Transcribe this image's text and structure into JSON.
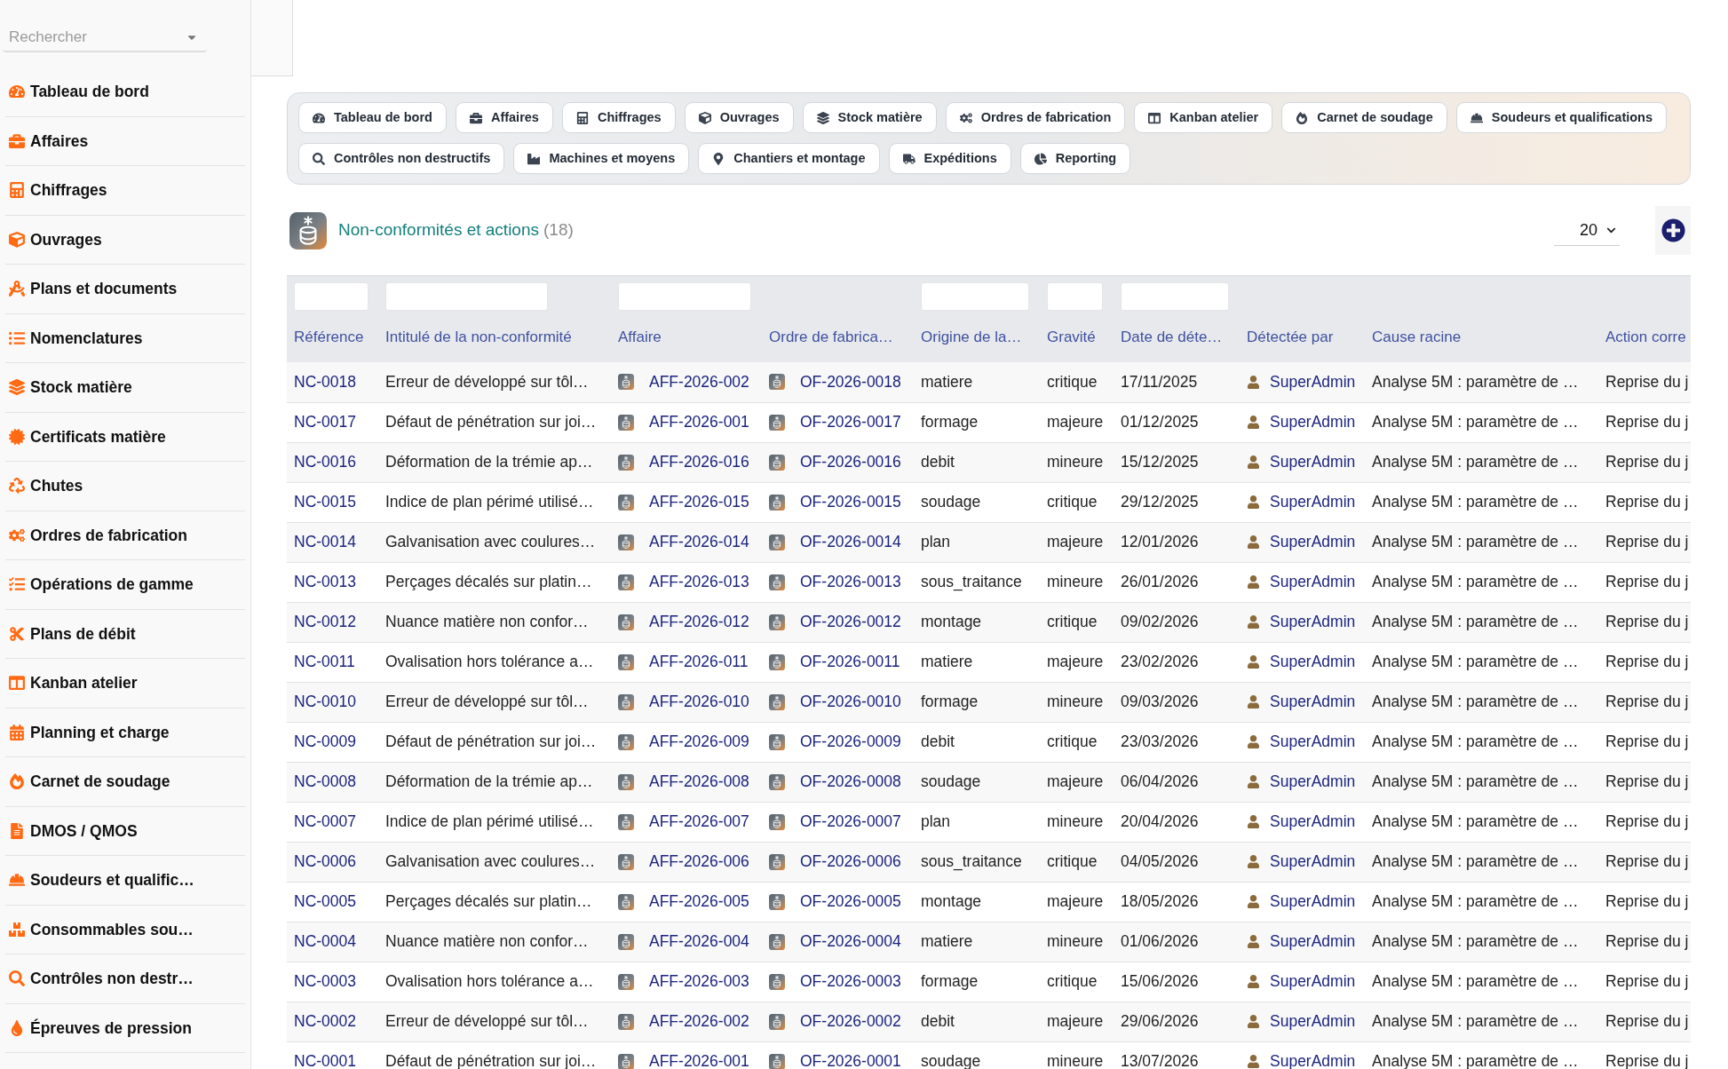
{
  "sidebar": {
    "search": {
      "placeholder": "Rechercher"
    },
    "items": [
      {
        "label": "Tableau de bord"
      },
      {
        "label": "Affaires"
      },
      {
        "label": "Chiffrages"
      },
      {
        "label": "Ouvrages"
      },
      {
        "label": "Plans et documents"
      },
      {
        "label": "Nomenclatures"
      },
      {
        "label": "Stock matière"
      },
      {
        "label": "Certificats matière"
      },
      {
        "label": "Chutes"
      },
      {
        "label": "Ordres de fabrication"
      },
      {
        "label": "Opérations de gamme"
      },
      {
        "label": "Plans de débit"
      },
      {
        "label": "Kanban atelier"
      },
      {
        "label": "Planning et charge"
      },
      {
        "label": "Carnet de soudage"
      },
      {
        "label": "DMOS / QMOS"
      },
      {
        "label": "Soudeurs et qualific…"
      },
      {
        "label": "Consommables sou…"
      },
      {
        "label": "Contrôles non destr…"
      },
      {
        "label": "Épreuves de pression"
      }
    ]
  },
  "shortcut_rows": [
    [
      {
        "label": "Tableau de bord"
      },
      {
        "label": "Affaires"
      },
      {
        "label": "Chiffrages"
      },
      {
        "label": "Ouvrages"
      },
      {
        "label": "Stock matière"
      },
      {
        "label": "Ordres de fabrication"
      },
      {
        "label": "Kanban atelier"
      },
      {
        "label": "Carnet de soudage"
      },
      {
        "label": "Soudeurs et qualifications"
      }
    ],
    [
      {
        "label": "Contrôles non destructifs"
      },
      {
        "label": "Machines et moyens"
      },
      {
        "label": "Chantiers et montage"
      },
      {
        "label": "Expéditions"
      },
      {
        "label": "Reporting"
      }
    ]
  ],
  "page_header": {
    "title": "Non-conformités et actions",
    "count": "(18)",
    "page_size": "20"
  },
  "table": {
    "columns": [
      {
        "label": "Référence",
        "filter": true
      },
      {
        "label": "Intitulé de la non-conformité",
        "filter": true
      },
      {
        "label": "Affaire",
        "filter": true
      },
      {
        "label": "Ordre de fabrica…",
        "filter": false
      },
      {
        "label": "Origine de la…",
        "filter": true
      },
      {
        "label": "Gravité",
        "filter": true
      },
      {
        "label": "Date de déte…",
        "filter": true
      },
      {
        "label": "Détectée par",
        "filter": false
      },
      {
        "label": "Cause racine",
        "filter": false
      },
      {
        "label": "Action corre",
        "filter": false
      }
    ],
    "rows": [
      {
        "reference": "NC-0018",
        "title": "Erreur de développé sur tôl…",
        "affaire": "AFF-2026-002",
        "ordre": "OF-2026-0018",
        "origine": "matiere",
        "gravite": "critique",
        "date": "17/11/2025",
        "detectee_par": "SuperAdmin",
        "cause": "Analyse 5M : paramètre de …",
        "column_10": "Reprise du j"
      },
      {
        "reference": "NC-0017",
        "title": "Défaut de pénétration sur joi…",
        "affaire": "AFF-2026-001",
        "ordre": "OF-2026-0017",
        "origine": "formage",
        "gravite": "majeure",
        "date": "01/12/2025",
        "detectee_par": "SuperAdmin",
        "cause": "Analyse 5M : paramètre de …",
        "column_10": "Reprise du j"
      },
      {
        "reference": "NC-0016",
        "title": "Déformation de la trémie ap…",
        "affaire": "AFF-2026-016",
        "ordre": "OF-2026-0016",
        "origine": "debit",
        "gravite": "mineure",
        "date": "15/12/2025",
        "detectee_par": "SuperAdmin",
        "cause": "Analyse 5M : paramètre de …",
        "column_10": "Reprise du j"
      },
      {
        "reference": "NC-0015",
        "title": "Indice de plan périmé utilisé…",
        "affaire": "AFF-2026-015",
        "ordre": "OF-2026-0015",
        "origine": "soudage",
        "gravite": "critique",
        "date": "29/12/2025",
        "detectee_par": "SuperAdmin",
        "cause": "Analyse 5M : paramètre de …",
        "column_10": "Reprise du j"
      },
      {
        "reference": "NC-0014",
        "title": "Galvanisation avec coulures…",
        "affaire": "AFF-2026-014",
        "ordre": "OF-2026-0014",
        "origine": "plan",
        "gravite": "majeure",
        "date": "12/01/2026",
        "detectee_par": "SuperAdmin",
        "cause": "Analyse 5M : paramètre de …",
        "column_10": "Reprise du j"
      },
      {
        "reference": "NC-0013",
        "title": "Perçages décalés sur platin…",
        "affaire": "AFF-2026-013",
        "ordre": "OF-2026-0013",
        "origine": "sous_traitance",
        "gravite": "mineure",
        "date": "26/01/2026",
        "detectee_par": "SuperAdmin",
        "cause": "Analyse 5M : paramètre de …",
        "column_10": "Reprise du j"
      },
      {
        "reference": "NC-0012",
        "title": "Nuance matière non confor…",
        "affaire": "AFF-2026-012",
        "ordre": "OF-2026-0012",
        "origine": "montage",
        "gravite": "critique",
        "date": "09/02/2026",
        "detectee_par": "SuperAdmin",
        "cause": "Analyse 5M : paramètre de …",
        "column_10": "Reprise du j"
      },
      {
        "reference": "NC-0011",
        "title": "Ovalisation hors tolérance a…",
        "affaire": "AFF-2026-011",
        "ordre": "OF-2026-0011",
        "origine": "matiere",
        "gravite": "majeure",
        "date": "23/02/2026",
        "detectee_par": "SuperAdmin",
        "cause": "Analyse 5M : paramètre de …",
        "column_10": "Reprise du j"
      },
      {
        "reference": "NC-0010",
        "title": "Erreur de développé sur tôl…",
        "affaire": "AFF-2026-010",
        "ordre": "OF-2026-0010",
        "origine": "formage",
        "gravite": "mineure",
        "date": "09/03/2026",
        "detectee_par": "SuperAdmin",
        "cause": "Analyse 5M : paramètre de …",
        "column_10": "Reprise du j"
      },
      {
        "reference": "NC-0009",
        "title": "Défaut de pénétration sur joi…",
        "affaire": "AFF-2026-009",
        "ordre": "OF-2026-0009",
        "origine": "debit",
        "gravite": "critique",
        "date": "23/03/2026",
        "detectee_par": "SuperAdmin",
        "cause": "Analyse 5M : paramètre de …",
        "column_10": "Reprise du j"
      },
      {
        "reference": "NC-0008",
        "title": "Déformation de la trémie ap…",
        "affaire": "AFF-2026-008",
        "ordre": "OF-2026-0008",
        "origine": "soudage",
        "gravite": "majeure",
        "date": "06/04/2026",
        "detectee_par": "SuperAdmin",
        "cause": "Analyse 5M : paramètre de …",
        "column_10": "Reprise du j"
      },
      {
        "reference": "NC-0007",
        "title": "Indice de plan périmé utilisé…",
        "affaire": "AFF-2026-007",
        "ordre": "OF-2026-0007",
        "origine": "plan",
        "gravite": "mineure",
        "date": "20/04/2026",
        "detectee_par": "SuperAdmin",
        "cause": "Analyse 5M : paramètre de …",
        "column_10": "Reprise du j"
      },
      {
        "reference": "NC-0006",
        "title": "Galvanisation avec coulures…",
        "affaire": "AFF-2026-006",
        "ordre": "OF-2026-0006",
        "origine": "sous_traitance",
        "gravite": "critique",
        "date": "04/05/2026",
        "detectee_par": "SuperAdmin",
        "cause": "Analyse 5M : paramètre de …",
        "column_10": "Reprise du j"
      },
      {
        "reference": "NC-0005",
        "title": "Perçages décalés sur platin…",
        "affaire": "AFF-2026-005",
        "ordre": "OF-2026-0005",
        "origine": "montage",
        "gravite": "majeure",
        "date": "18/05/2026",
        "detectee_par": "SuperAdmin",
        "cause": "Analyse 5M : paramètre de …",
        "column_10": "Reprise du j"
      },
      {
        "reference": "NC-0004",
        "title": "Nuance matière non confor…",
        "affaire": "AFF-2026-004",
        "ordre": "OF-2026-0004",
        "origine": "matiere",
        "gravite": "mineure",
        "date": "01/06/2026",
        "detectee_par": "SuperAdmin",
        "cause": "Analyse 5M : paramètre de …",
        "column_10": "Reprise du j"
      },
      {
        "reference": "NC-0003",
        "title": "Ovalisation hors tolérance a…",
        "affaire": "AFF-2026-003",
        "ordre": "OF-2026-0003",
        "origine": "formage",
        "gravite": "critique",
        "date": "15/06/2026",
        "detectee_par": "SuperAdmin",
        "cause": "Analyse 5M : paramètre de …",
        "column_10": "Reprise du j"
      },
      {
        "reference": "NC-0002",
        "title": "Erreur de développé sur tôl…",
        "affaire": "AFF-2026-002",
        "ordre": "OF-2026-0002",
        "origine": "debit",
        "gravite": "majeure",
        "date": "29/06/2026",
        "detectee_par": "SuperAdmin",
        "cause": "Analyse 5M : paramètre de …",
        "column_10": "Reprise du j"
      },
      {
        "reference": "NC-0001",
        "title": "Défaut de pénétration sur joi…",
        "affaire": "AFF-2026-001",
        "ordre": "OF-2026-0001",
        "origine": "soudage",
        "gravite": "mineure",
        "date": "13/07/2026",
        "detectee_par": "SuperAdmin",
        "cause": "Analyse 5M : paramètre de …",
        "column_10": "Reprise du j"
      }
    ]
  }
}
